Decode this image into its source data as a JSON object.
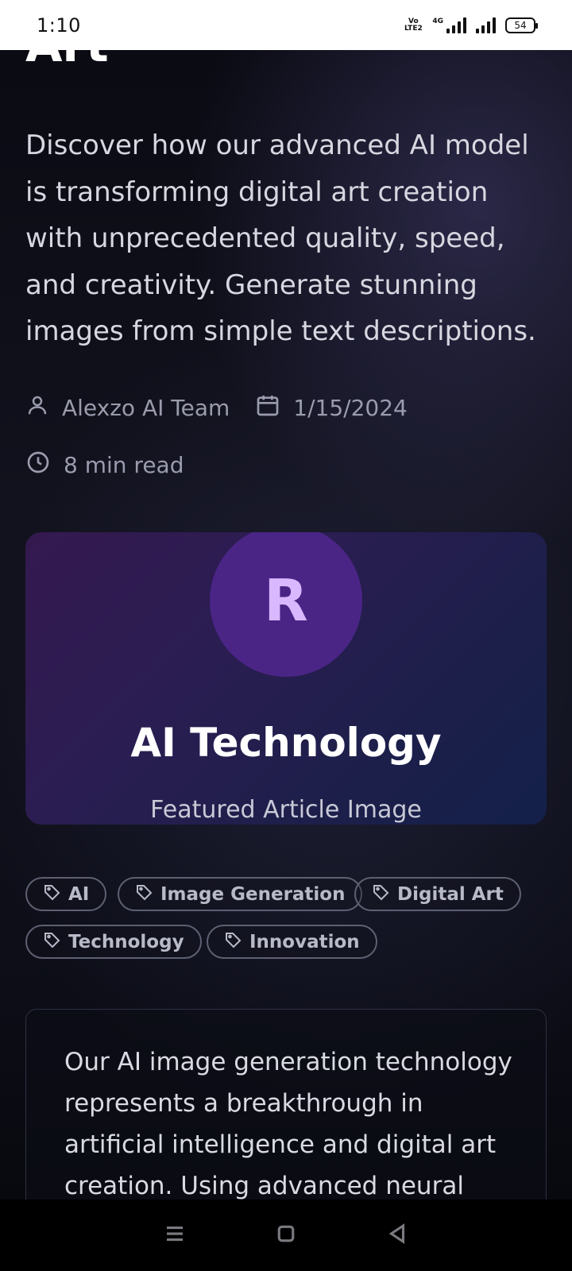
{
  "status_bar": {
    "time": "1:10",
    "volte_label": "Vo LTE2",
    "network_label": "4G",
    "battery": "54"
  },
  "article": {
    "title_fragment": "Art",
    "intro": "Discover how our advanced AI model is transforming digital art creation with unprecedented quality, speed, and creativity. Generate stunning images from simple text descriptions.",
    "author": "Alexzo AI Team",
    "date": "1/15/2024",
    "read_time": "8 min read"
  },
  "featured_image": {
    "letter": "R",
    "title": "AI Technology",
    "caption": "Featured Article Image"
  },
  "tags": [
    "AI",
    "Image Generation",
    "Digital Art",
    "Technology",
    "Innovation"
  ],
  "body": {
    "text": "Our AI image generation technology represents a breakthrough in artificial intelligence and digital art creation. Using advanced neural"
  },
  "colors": {
    "accent_purple": "#4a2586",
    "circle_letter": "#d9b8ff",
    "muted_text": "#9a9cad"
  }
}
